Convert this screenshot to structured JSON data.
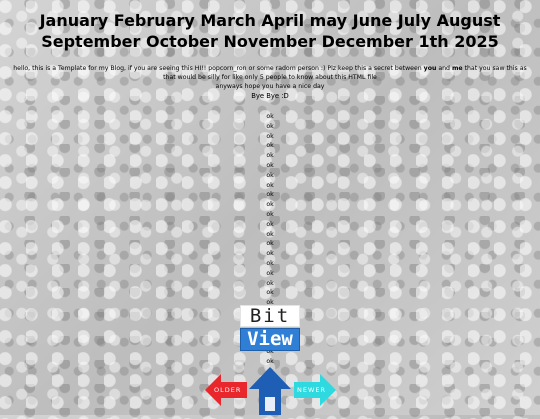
{
  "header": {
    "title": "January February March April may June July August September October November December 1th 2025"
  },
  "intro": {
    "line1_part1": "hello, this is a Template for my Blog, if you are seeing this HI!! popcorn_ron or some radom person :) Plz keep this a secret between ",
    "line1_you": "you",
    "line1_and": " and ",
    "line1_me": "me",
    "line1_part2": " that you saw this as that would be silly for like only 5 people to know about this HTML file",
    "line2": "anyways hope you have a nice day",
    "bye": "Bye Bye :D"
  },
  "ok_items": [
    "ok",
    "ok",
    "ok",
    "ok",
    "ok",
    "ok",
    "ok",
    "ok",
    "ok",
    "ok",
    "ok",
    "ok",
    "ok",
    "ok",
    "ok",
    "ok",
    "ok",
    "ok",
    "ok",
    "ok",
    "ok",
    "ok",
    "ok",
    "ok",
    "ok",
    "ok",
    "ok",
    "ok",
    "ok",
    "ok"
  ],
  "logo": {
    "top_text": "Bit",
    "bottom_text": "View"
  },
  "nav": {
    "older_label": "OLDER",
    "newer_label": "NEWER",
    "home_icon": "home-icon"
  },
  "colors": {
    "older_arrow": "#e8262b",
    "home_arrow": "#1e5fb5",
    "newer_arrow": "#2fd9e0",
    "bitview_blue": "#2f7fd6"
  }
}
